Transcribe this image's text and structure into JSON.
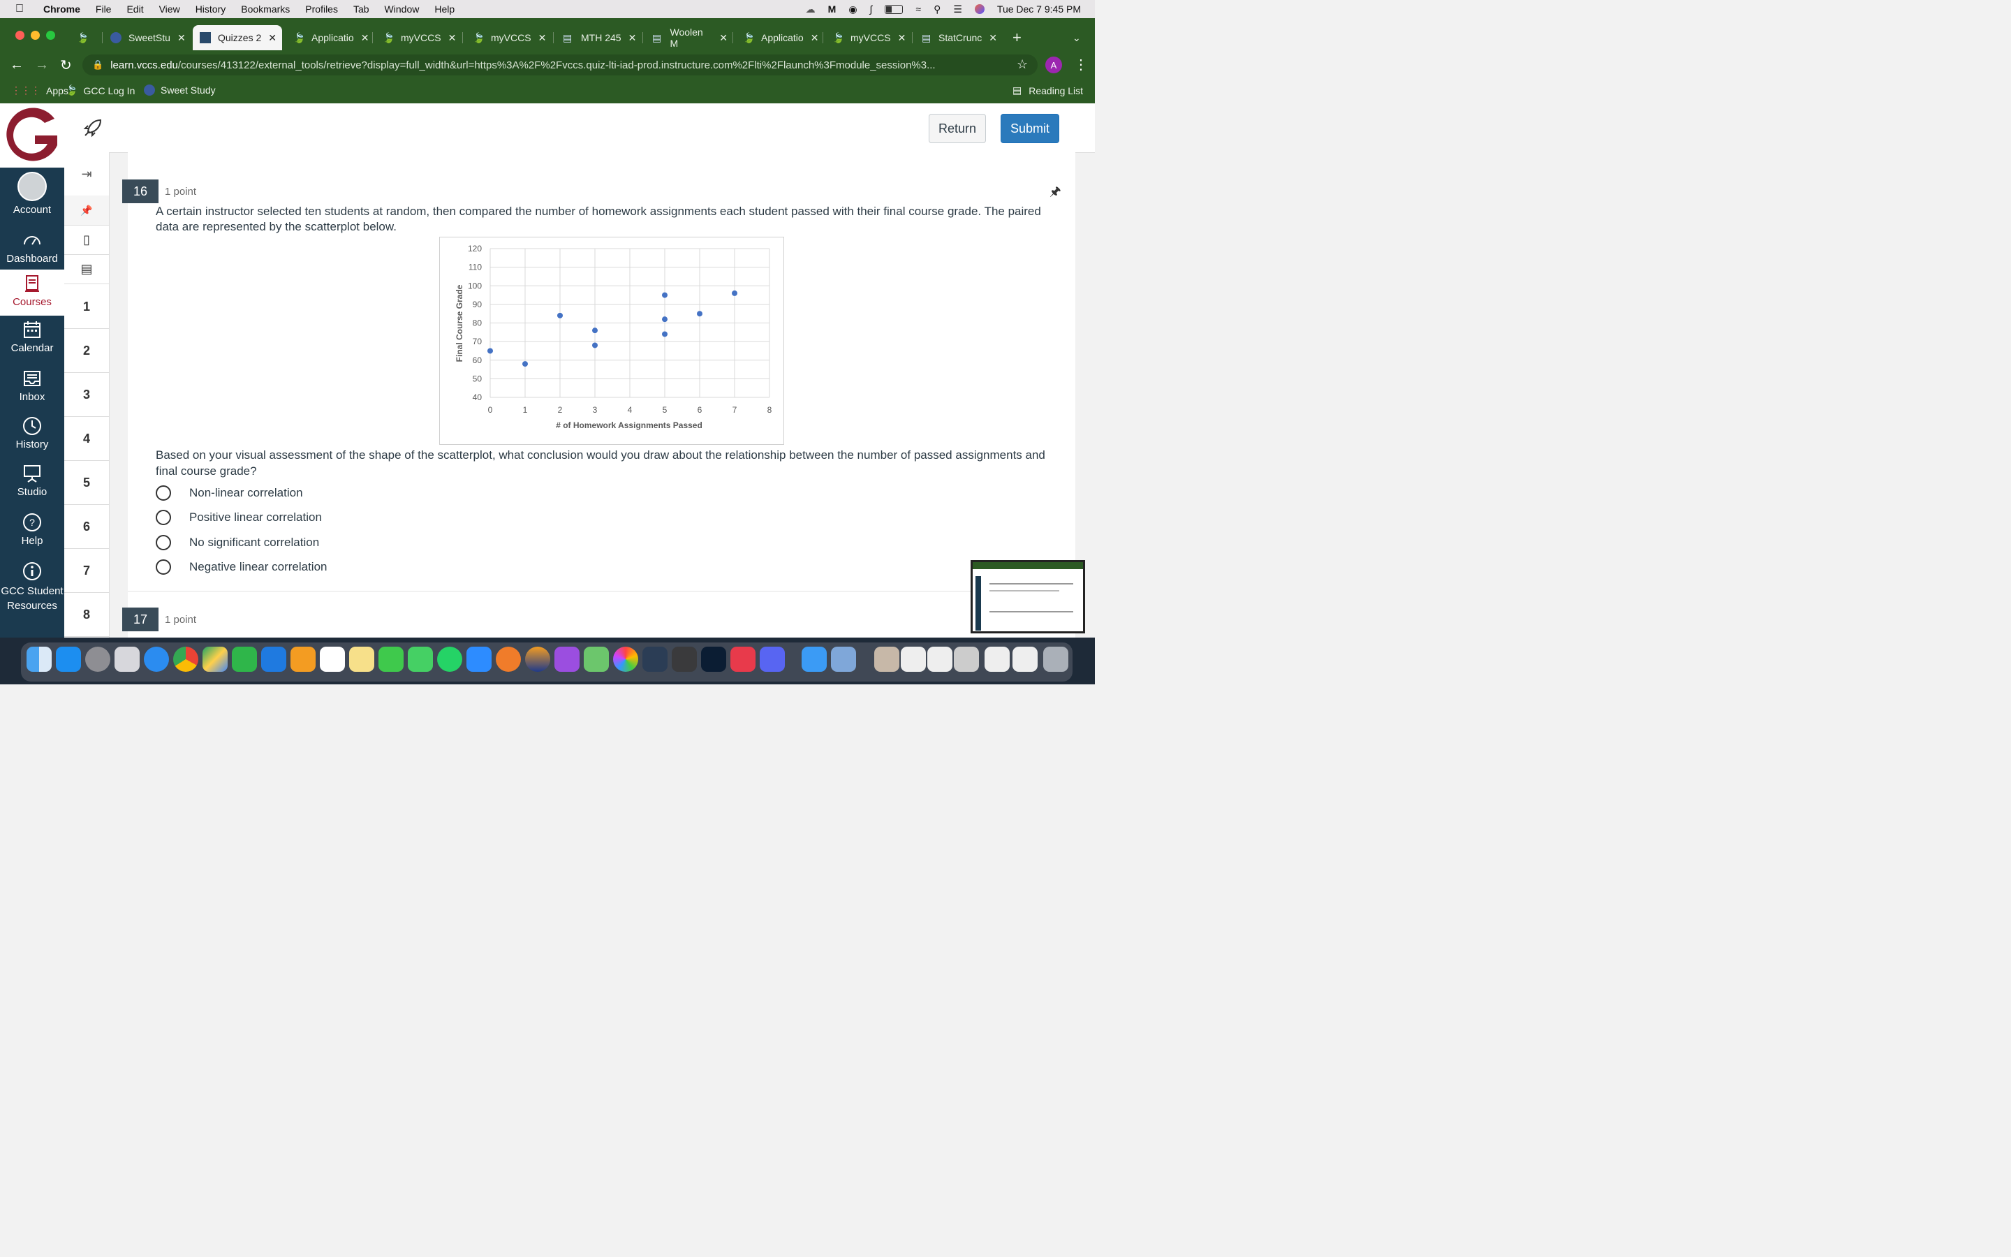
{
  "menubar": {
    "app": "Chrome",
    "items": [
      "File",
      "Edit",
      "View",
      "History",
      "Bookmarks",
      "Profiles",
      "Tab",
      "Window",
      "Help"
    ],
    "datetime": "Tue Dec 7  9:45 PM"
  },
  "tabs": [
    {
      "label": ""
    },
    {
      "label": "SweetStu"
    },
    {
      "label": "Quizzes 2"
    },
    {
      "label": "Applicatio"
    },
    {
      "label": "myVCCS"
    },
    {
      "label": "myVCCS"
    },
    {
      "label": "MTH 245"
    },
    {
      "label": "Woolen M"
    },
    {
      "label": "Applicatio"
    },
    {
      "label": "myVCCS"
    },
    {
      "label": "StatCrunc"
    }
  ],
  "omnibox": {
    "host": "learn.vccs.edu",
    "path": "/courses/413122/external_tools/retrieve?display=full_width&url=https%3A%2F%2Fvccs.quiz-lti-iad-prod.instructure.com%2Flti%2Flaunch%3Fmodule_session%3..."
  },
  "profile_initial": "A",
  "bookmarks": [
    {
      "label": "Apps"
    },
    {
      "label": "GCC Log In"
    },
    {
      "label": "Sweet Study"
    }
  ],
  "reading_list": "Reading List",
  "buttons": {
    "return": "Return",
    "submit": "Submit"
  },
  "leftnav": [
    {
      "label": "Account"
    },
    {
      "label": "Dashboard"
    },
    {
      "label": "Courses"
    },
    {
      "label": "Calendar"
    },
    {
      "label": "Inbox"
    },
    {
      "label": "History"
    },
    {
      "label": "Studio"
    },
    {
      "label": "Help"
    },
    {
      "label": "GCC Student Resources"
    }
  ],
  "question_nav": [
    "1",
    "2",
    "3",
    "4",
    "5",
    "6",
    "7",
    "8"
  ],
  "question16": {
    "number": "16",
    "points": "1 point",
    "text": "A certain instructor selected ten students at random, then compared the number of homework assignments each student passed with their final course grade. The paired data are represented by the scatterplot below.",
    "prompt": "Based on your visual assessment of the shape of the scatterplot, what conclusion would you draw about the relationship between the number of passed assignments and final course grade?",
    "options": [
      "Non-linear correlation",
      "Positive linear correlation",
      "No significant correlation",
      "Negative linear correlation"
    ]
  },
  "question17": {
    "number": "17",
    "points": "1 point"
  },
  "chart_data": {
    "type": "scatter",
    "xlabel": "# of Homework Assignments Passed",
    "ylabel": "Final Course Grade",
    "xlim": [
      0,
      8
    ],
    "ylim": [
      40,
      120
    ],
    "xticks": [
      "0",
      "1",
      "2",
      "3",
      "4",
      "5",
      "6",
      "7",
      "8"
    ],
    "yticks": [
      "40",
      "50",
      "60",
      "70",
      "80",
      "90",
      "100",
      "110",
      "120"
    ],
    "grid": true,
    "color": "#4472c4",
    "points": [
      {
        "x": 0,
        "y": 65
      },
      {
        "x": 1,
        "y": 58
      },
      {
        "x": 2,
        "y": 84
      },
      {
        "x": 3,
        "y": 76
      },
      {
        "x": 3,
        "y": 68
      },
      {
        "x": 5,
        "y": 95
      },
      {
        "x": 5,
        "y": 82
      },
      {
        "x": 5,
        "y": 74
      },
      {
        "x": 6,
        "y": 85
      },
      {
        "x": 7,
        "y": 96
      }
    ]
  }
}
